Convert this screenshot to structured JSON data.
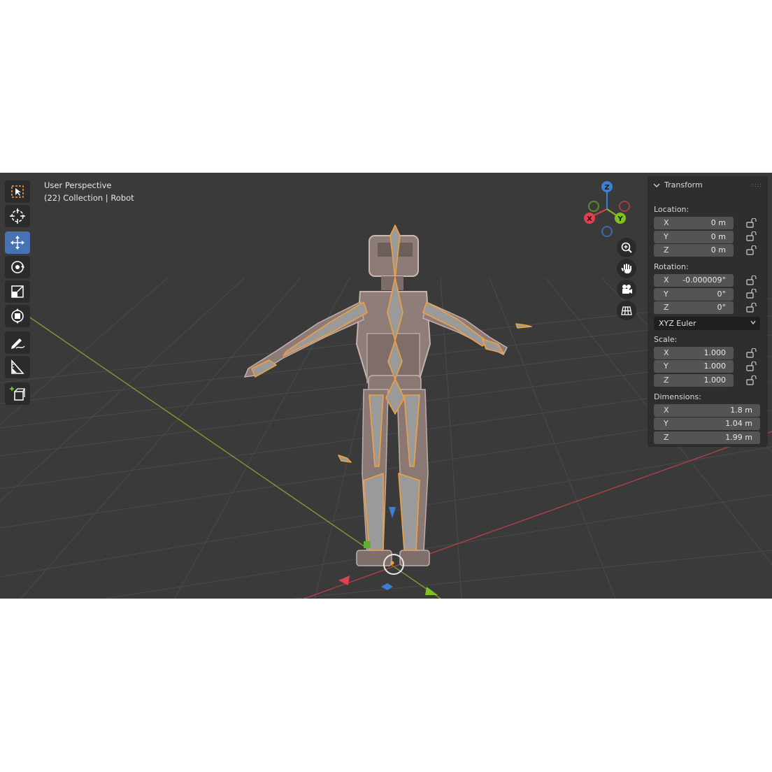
{
  "viewport": {
    "info_line1": "User Perspective",
    "info_line2": "(22) Collection | Robot"
  },
  "toolbar": {
    "tools": [
      "select-box-icon",
      "cursor-icon",
      "move-icon",
      "rotate-icon",
      "scale-icon",
      "transform-icon",
      "annotate-icon",
      "measure-icon",
      "add-cube-icon"
    ],
    "active": "move-icon"
  },
  "gizmo": {
    "x": "X",
    "y": "Y",
    "z": "Z"
  },
  "nav_icons": [
    "zoom-icon",
    "pan-hand-icon",
    "camera-icon",
    "grid-view-icon"
  ],
  "transform_panel": {
    "title": "Transform",
    "location_label": "Location:",
    "location": [
      {
        "axis": "X",
        "value": "0 m"
      },
      {
        "axis": "Y",
        "value": "0 m"
      },
      {
        "axis": "Z",
        "value": "0 m"
      }
    ],
    "rotation_label": "Rotation:",
    "rotation": [
      {
        "axis": "X",
        "value": "-0.000009°"
      },
      {
        "axis": "Y",
        "value": "0°"
      },
      {
        "axis": "Z",
        "value": "0°"
      }
    ],
    "rotation_mode": "XYZ Euler",
    "scale_label": "Scale:",
    "scale": [
      {
        "axis": "X",
        "value": "1.000"
      },
      {
        "axis": "Y",
        "value": "1.000"
      },
      {
        "axis": "Z",
        "value": "1.000"
      }
    ],
    "dimensions_label": "Dimensions:",
    "dimensions": [
      {
        "axis": "X",
        "value": "1.8 m"
      },
      {
        "axis": "Y",
        "value": "1.04 m"
      },
      {
        "axis": "Z",
        "value": "1.99 m"
      }
    ]
  },
  "colors": {
    "viewport_bg": "#3a3a3a",
    "panel_bg": "#2e2e2e",
    "active_tool": "#4772b3",
    "selection_orange": "#f0a040",
    "axis_x": "#e04050",
    "axis_y": "#80c020",
    "axis_z": "#3a80d8"
  }
}
